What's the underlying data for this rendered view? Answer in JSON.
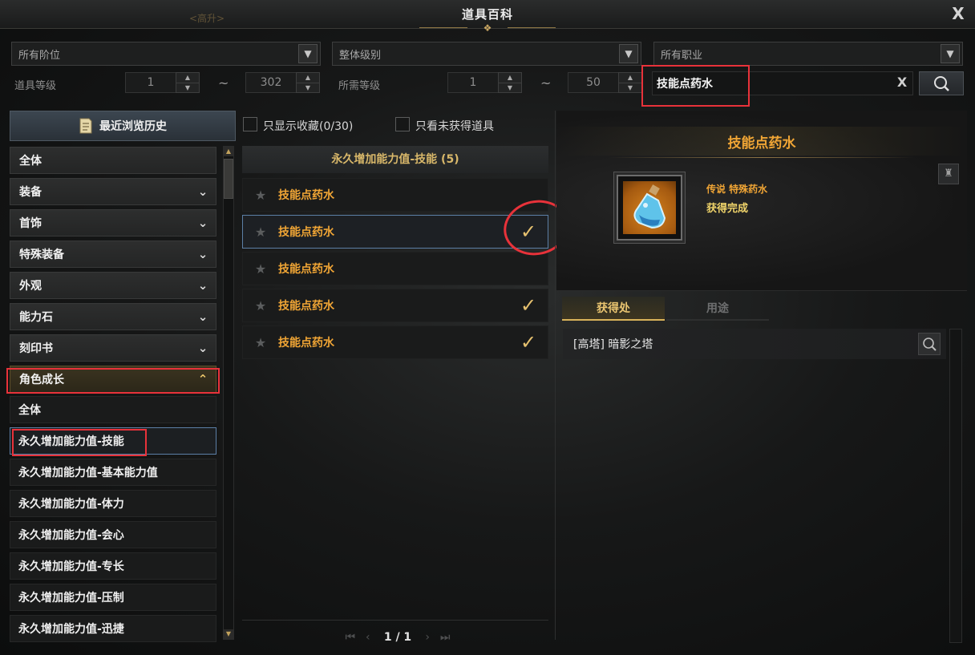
{
  "window": {
    "title": "道具百科",
    "close_label": "X",
    "bg_location": "<高升>"
  },
  "filters": {
    "tier_dropdown": "所有阶位",
    "level_dropdown": "整体级别",
    "class_dropdown": "所有职业",
    "item_level_label": "道具等级",
    "item_level_min": "1",
    "item_level_max": "302",
    "required_level_label": "所需等级",
    "required_level_min": "1",
    "required_level_max": "50",
    "range_separator": "~",
    "search_value": "技能点药水",
    "search_clear": "X"
  },
  "sidebar": {
    "history_button": "最近浏览历史",
    "categories": [
      {
        "label": "全体"
      },
      {
        "label": "装备"
      },
      {
        "label": "首饰"
      },
      {
        "label": "特殊装备"
      },
      {
        "label": "外观"
      },
      {
        "label": "能力石"
      },
      {
        "label": "刻印书"
      },
      {
        "label": "角色成长"
      }
    ],
    "subcategories": [
      {
        "label": "全体"
      },
      {
        "label": "永久增加能力值-技能"
      },
      {
        "label": "永久增加能力值-基本能力值"
      },
      {
        "label": "永久增加能力值-体力"
      },
      {
        "label": "永久增加能力值-会心"
      },
      {
        "label": "永久增加能力值-专长"
      },
      {
        "label": "永久增加能力值-压制"
      },
      {
        "label": "永久增加能力值-迅捷"
      }
    ]
  },
  "list": {
    "show_favorites_label": "只显示收藏(0/30)",
    "show_unobtained_label": "只看未获得道具",
    "header": "永久增加能力值-技能 (5)",
    "items": [
      {
        "name": "技能点药水",
        "obtained": false
      },
      {
        "name": "技能点药水",
        "obtained": true
      },
      {
        "name": "技能点药水",
        "obtained": false
      },
      {
        "name": "技能点药水",
        "obtained": true
      },
      {
        "name": "技能点药水",
        "obtained": true
      }
    ],
    "pager": "1 / 1"
  },
  "detail": {
    "title": "技能点药水",
    "grade": "传说 特殊药水",
    "status": "获得完成",
    "tab_source": "获得处",
    "tab_usage": "用途",
    "source_entry": "[高塔] 暗影之塔"
  },
  "colors": {
    "accent_gold": "#e9c470",
    "item_orange": "#f0a535",
    "highlight_red": "#e8323a",
    "select_blue": "#5c7fa6"
  }
}
